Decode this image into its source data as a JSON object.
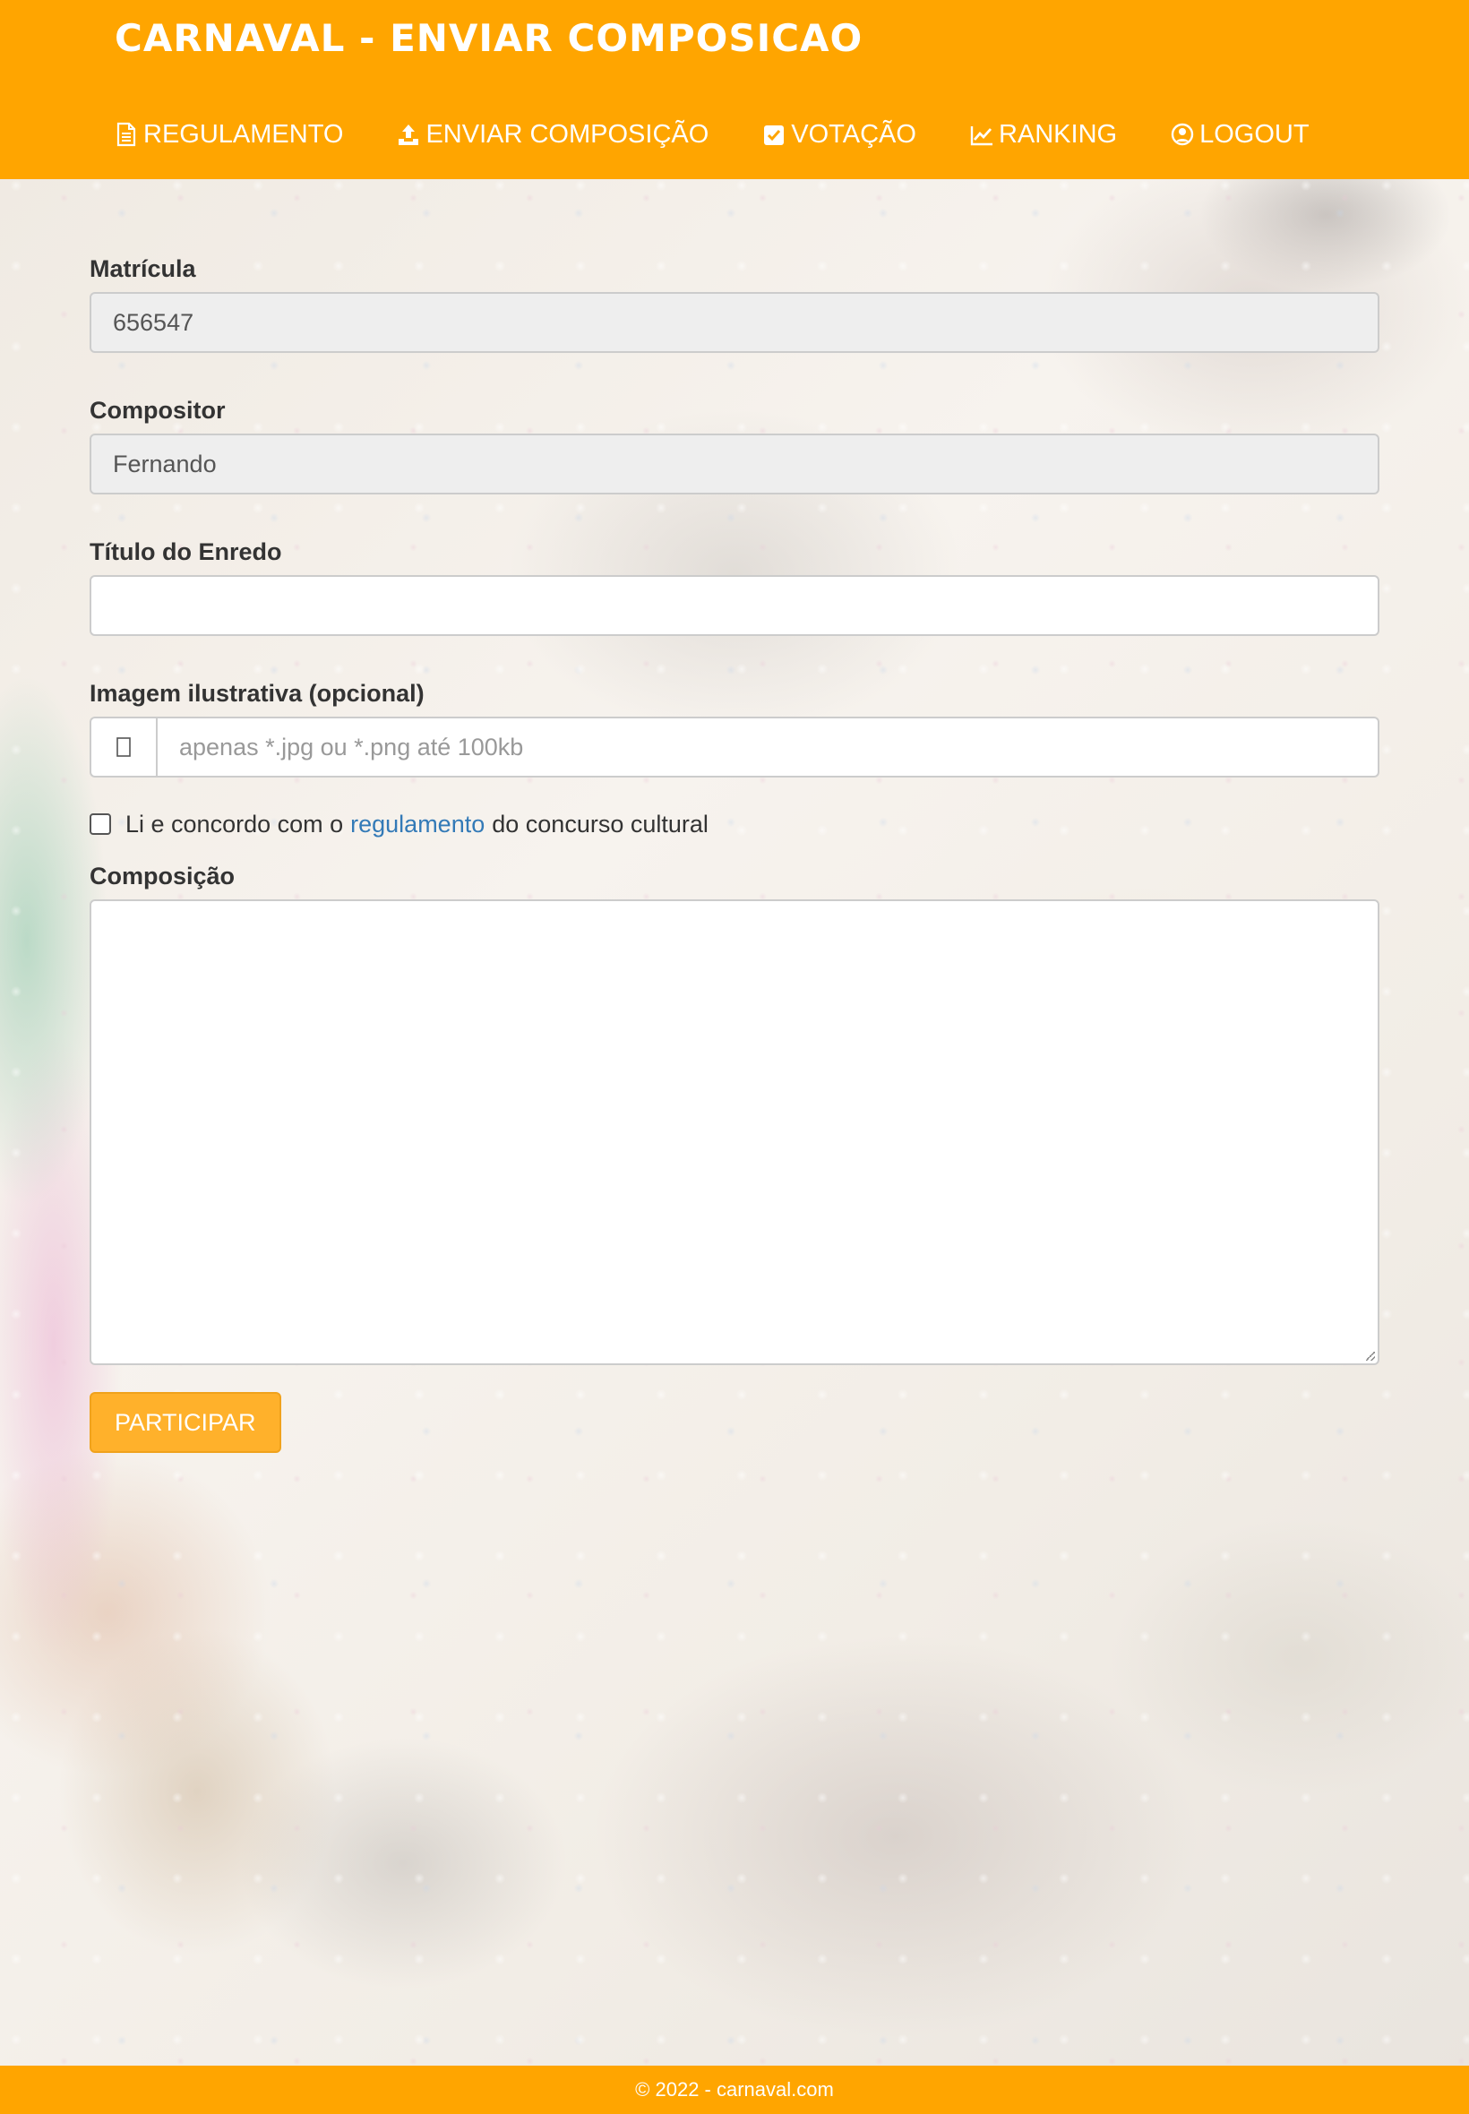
{
  "app": {
    "title": "CARNAVAL - ENVIAR COMPOSICAO"
  },
  "nav": {
    "items": [
      {
        "label": "REGULAMENTO",
        "icon": "document-icon"
      },
      {
        "label": "ENVIAR COMPOSIÇÃO",
        "icon": "upload-icon"
      },
      {
        "label": "VOTAÇÃO",
        "icon": "check-square-icon"
      },
      {
        "label": "RANKING",
        "icon": "line-chart-icon"
      },
      {
        "label": "LOGOUT",
        "icon": "user-circle-icon"
      }
    ]
  },
  "form": {
    "matricula": {
      "label": "Matrícula",
      "value": "656547"
    },
    "compositor": {
      "label": "Compositor",
      "value": "Fernando"
    },
    "titulo": {
      "label": "Título do Enredo",
      "value": ""
    },
    "imagem": {
      "label": "Imagem ilustrativa (opcional)",
      "placeholder": "apenas *.jpg ou *.png até 100kb",
      "icon": "file-icon"
    },
    "agree": {
      "checked": false,
      "text_before": "Li e concordo com o",
      "link": "regulamento",
      "text_after": "do concurso cultural"
    },
    "composicao": {
      "label": "Composição",
      "value": ""
    },
    "submit_label": "PARTICIPAR"
  },
  "footer": {
    "text": "© 2022 - carnaval.com"
  },
  "colors": {
    "accent": "#ffa500",
    "button": "#ffb12b",
    "link": "#337ab7"
  }
}
